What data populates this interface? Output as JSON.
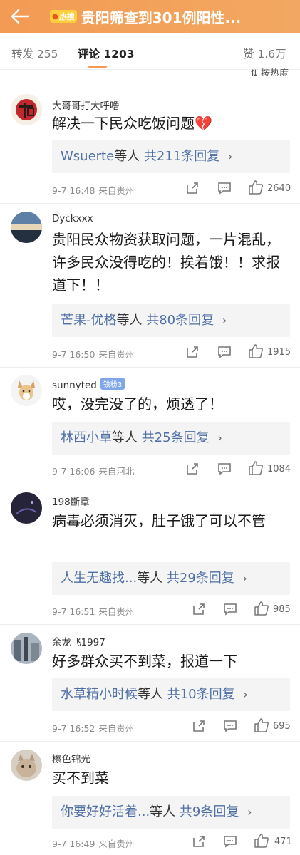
{
  "header": {
    "hot_badge": "热搜",
    "title": "贵阳筛查到301例阳性..."
  },
  "tabs": {
    "repost": "转发 255",
    "comments": "评论 1203",
    "likes": "赞 1.6万"
  },
  "sort_label": "按热度",
  "comments": [
    {
      "username": "大哥哥打大呼噜",
      "text": "解决一下民众吃饭问题💔",
      "reply_names": "Wsuerte",
      "reply_mid": "等人",
      "reply_count": "共211条回复",
      "time": "9-7 16:48",
      "location": "来自贵州",
      "likes": "2640"
    },
    {
      "username": "Dyckxxx",
      "text": "贵阳民众物资获取问题，一片混乱，许多民众没得吃的！挨着饿！！求报道下！！",
      "reply_names": "芒果-优格",
      "reply_mid": "等人",
      "reply_count": "共80条回复",
      "time": "9-7 16:50",
      "location": "来自贵州",
      "likes": "1915"
    },
    {
      "username": "sunnyted",
      "badge": "铁粉3",
      "text": "哎，没完没了的，烦透了！",
      "reply_names": "林西小草",
      "reply_mid": "等人",
      "reply_count": "共25条回复",
      "time": "9-7 16:06",
      "location": "来自河北",
      "likes": "1084"
    },
    {
      "username": "198斷章",
      "text": "病毒必须消灭，肚子饿了可以不管",
      "reply_names": "人生无趣找...",
      "reply_mid": "等人",
      "reply_count": "共29条回复",
      "time": "9-7 16:51",
      "location": "来自贵州",
      "likes": "985"
    },
    {
      "username": "余龙飞1997",
      "text": "好多群众买不到菜，报道一下",
      "reply_names": "水草精小时候",
      "reply_mid": "等人",
      "reply_count": "共10条回复",
      "time": "9-7 16:52",
      "location": "来自贵州",
      "likes": "695"
    },
    {
      "username": "檫色锦光",
      "text": "买不到菜",
      "reply_names": "你要好好活着...",
      "reply_mid": "等人",
      "reply_count": "共9条回复",
      "time": "9-7 16:49",
      "location": "来自贵州",
      "likes": "471"
    }
  ],
  "colors": {
    "header": "#f39a54",
    "link": "#4f6fa5"
  }
}
